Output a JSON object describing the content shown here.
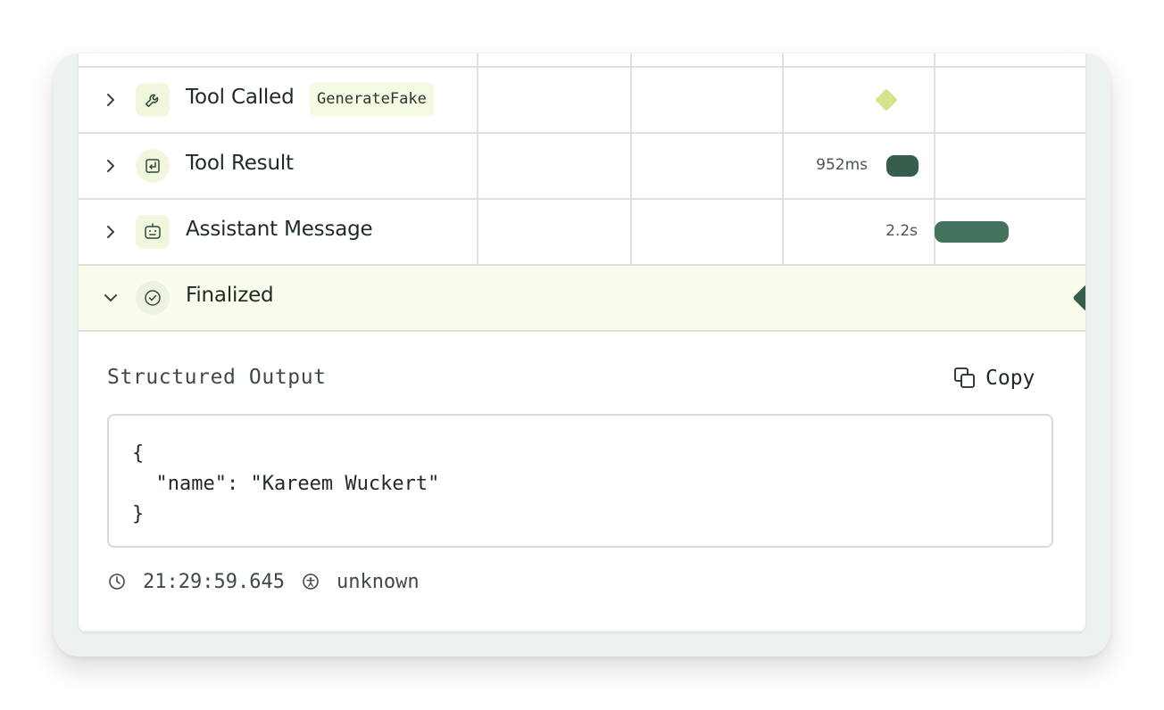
{
  "rows": [
    {
      "label": "Tool Called",
      "chip": "GenerateFake",
      "duration": ""
    },
    {
      "label": "Tool Result",
      "duration": "952ms"
    },
    {
      "label": "Assistant Message",
      "duration": "2.2s"
    },
    {
      "label": "Finalized",
      "duration": ""
    }
  ],
  "detail": {
    "section_title": "Structured Output",
    "copy_label": "Copy",
    "code": "{\n  \"name\": \"Kareem Wuckert\"\n}",
    "timestamp": "21:29:59.645",
    "actor": "unknown"
  },
  "colors": {
    "accent_dark": "#3f6b58",
    "diamond": "#d6e28c",
    "selected_row": "#fafdec",
    "icon_bg": "#f1f6dd"
  }
}
